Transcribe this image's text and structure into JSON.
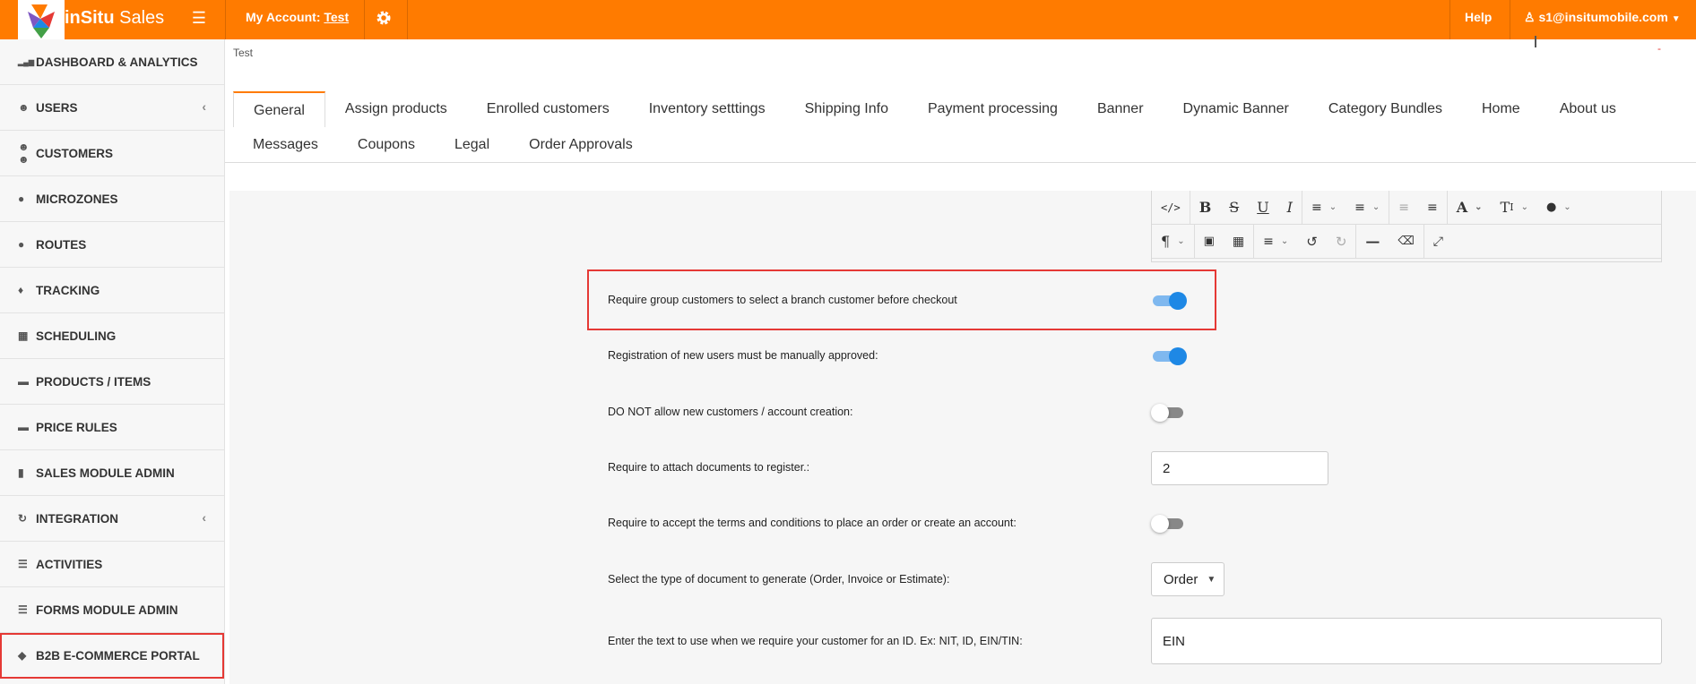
{
  "header": {
    "brand_bold": "inSitu",
    "brand_light": "Sales",
    "account_label": "My Account:",
    "account_name": "Test",
    "help_label": "Help",
    "user_email": "s1@insitumobile.com",
    "accent_color": "#ff7b00"
  },
  "sidebar": {
    "items": [
      {
        "label": "DASHBOARD & ANALYTICS",
        "icon": "bar-chart-icon"
      },
      {
        "label": "USERS",
        "icon": "user-icon",
        "expandable": true
      },
      {
        "label": "CUSTOMERS",
        "icon": "users-icon"
      },
      {
        "label": "MICROZONES",
        "icon": "globe-icon"
      },
      {
        "label": "ROUTES",
        "icon": "globe-icon"
      },
      {
        "label": "TRACKING",
        "icon": "map-marker-icon"
      },
      {
        "label": "SCHEDULING",
        "icon": "calendar-icon"
      },
      {
        "label": "PRODUCTS / ITEMS",
        "icon": "briefcase-icon"
      },
      {
        "label": "PRICE RULES",
        "icon": "briefcase-icon"
      },
      {
        "label": "SALES MODULE ADMIN",
        "icon": "building-icon"
      },
      {
        "label": "INTEGRATION",
        "icon": "refresh-icon",
        "expandable": true
      },
      {
        "label": "ACTIVITIES",
        "icon": "list-alt-icon"
      },
      {
        "label": "FORMS MODULE ADMIN",
        "icon": "list-icon"
      },
      {
        "label": "B2B E-COMMERCE PORTAL",
        "icon": "tags-icon",
        "highlighted": true
      }
    ]
  },
  "breadcrumb": "Test",
  "tabs": {
    "row1": [
      "General",
      "Assign products",
      "Enrolled customers",
      "Inventory setttings",
      "Shipping Info",
      "Payment processing",
      "Banner",
      "Dynamic Banner",
      "Category Bundles",
      "Home",
      "About us"
    ],
    "row2": [
      "Messages",
      "Coupons",
      "Legal",
      "Order Approvals"
    ],
    "active": "General"
  },
  "editor_toolbar": {
    "row1": [
      "code-view-icon",
      "bold-icon",
      "strikethrough-icon",
      "underline-icon",
      "italic-icon",
      "unordered-list-icon",
      "ordered-list-icon",
      "outdent-icon",
      "indent-icon",
      "text-color-icon",
      "font-size-icon",
      "fill-color-icon"
    ],
    "row2": [
      "paragraph-format-icon",
      "insert-image-icon",
      "insert-table-icon",
      "align-icon",
      "undo-icon",
      "redo-icon",
      "horizontal-line-icon",
      "clear-formatting-icon",
      "fullscreen-icon"
    ]
  },
  "settings": {
    "branch_required": {
      "label": "Require group customers to select a branch customer before checkout",
      "enabled": true
    },
    "manual_approval": {
      "label": "Registration of new users must be manually approved:",
      "enabled": true
    },
    "no_account_creation": {
      "label": "DO NOT allow new customers / account creation:",
      "enabled": false
    },
    "attach_documents": {
      "label": "Require to attach documents to register.:",
      "value": "2"
    },
    "accept_terms": {
      "label": "Require to accept the terms and conditions to place an order or create an account:",
      "enabled": false
    },
    "document_type": {
      "label": "Select the type of document to generate (Order, Invoice or Estimate):",
      "value": "Order"
    },
    "id_text": {
      "label": "Enter the text to use when we require your customer for an ID. Ex: NIT, ID, EIN/TIN:",
      "value": "EIN"
    }
  }
}
